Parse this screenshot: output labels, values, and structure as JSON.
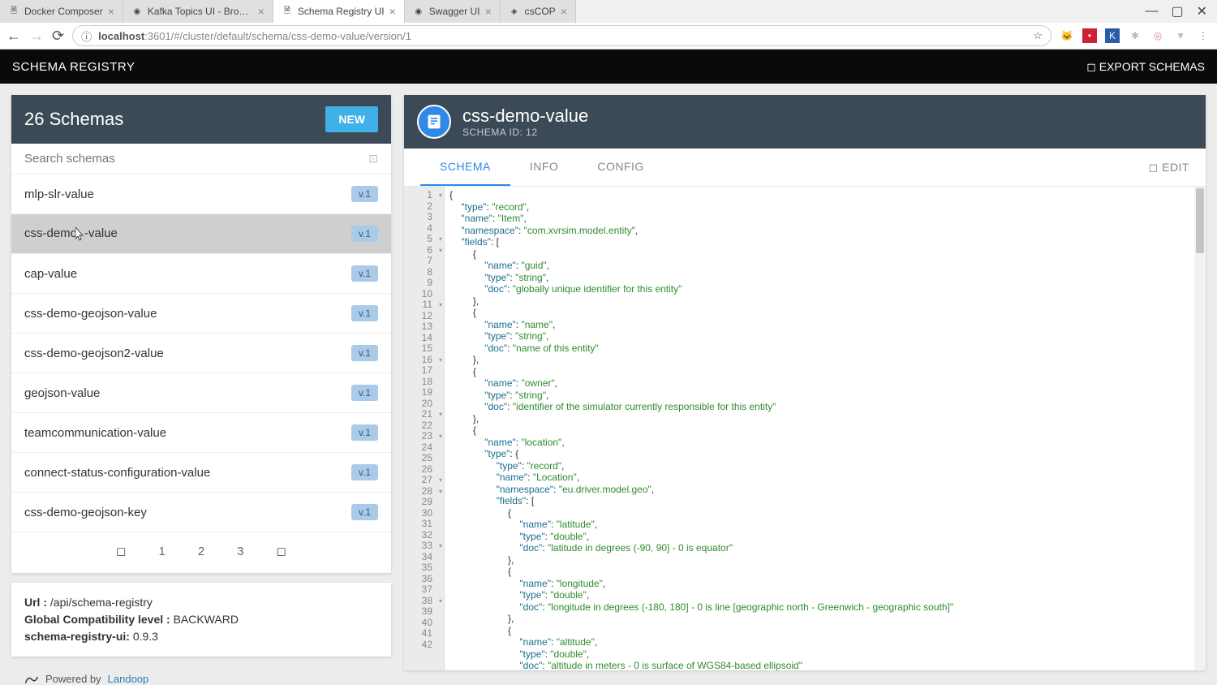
{
  "browser": {
    "tabs": [
      {
        "label": "Docker Composer",
        "icon": "🗎"
      },
      {
        "label": "Kafka Topics UI - Browse",
        "icon": "◉"
      },
      {
        "label": "Schema Registry UI",
        "icon": "🗎",
        "active": true
      },
      {
        "label": "Swagger UI",
        "icon": "◉"
      },
      {
        "label": "csCOP",
        "icon": "◈"
      }
    ],
    "url_host": "localhost",
    "url_port_path": ":3601/#/cluster/default/schema/css-demo-value/version/1"
  },
  "app": {
    "title": "SCHEMA REGISTRY",
    "export_label": "◻ EXPORT SCHEMAS"
  },
  "sidebar": {
    "header_title": "26 Schemas",
    "new_btn": "NEW",
    "search_placeholder": "Search schemas",
    "items": [
      {
        "name": "mlp-slr-value",
        "version": "v.1"
      },
      {
        "name": "css-demo-value",
        "version": "v.1",
        "active": true,
        "cursor_at": 8
      },
      {
        "name": "cap-value",
        "version": "v.1"
      },
      {
        "name": "css-demo-geojson-value",
        "version": "v.1"
      },
      {
        "name": "css-demo-geojson2-value",
        "version": "v.1"
      },
      {
        "name": "geojson-value",
        "version": "v.1"
      },
      {
        "name": "teamcommunication-value",
        "version": "v.1"
      },
      {
        "name": "connect-status-configuration-value",
        "version": "v.1"
      },
      {
        "name": "css-demo-geojson-key",
        "version": "v.1"
      }
    ],
    "pages": [
      "1",
      "2",
      "3"
    ]
  },
  "info": {
    "url_label": "Url :",
    "url_value": "/api/schema-registry",
    "compat_label": "Global Compatibility level :",
    "compat_value": "BACKWARD",
    "ver_label": "schema-registry-ui:",
    "ver_value": "0.9.3",
    "powered": "Powered by",
    "powered_link": "Landoop"
  },
  "content": {
    "title": "css-demo-value",
    "schema_id_label": "SCHEMA ID: 12",
    "tabs": {
      "schema": "SCHEMA",
      "info": "INFO",
      "config": "CONFIG"
    },
    "edit": "◻ EDIT"
  },
  "code_lines": [
    {
      "n": 1,
      "fold": true,
      "i": 0,
      "t": [
        {
          "p": "{"
        }
      ]
    },
    {
      "n": 2,
      "i": 1,
      "t": [
        {
          "k": "\"type\""
        },
        {
          "p": ": "
        },
        {
          "s": "\"record\""
        },
        {
          "p": ","
        }
      ]
    },
    {
      "n": 3,
      "i": 1,
      "t": [
        {
          "k": "\"name\""
        },
        {
          "p": ": "
        },
        {
          "s": "\"Item\""
        },
        {
          "p": ","
        }
      ]
    },
    {
      "n": 4,
      "i": 1,
      "t": [
        {
          "k": "\"namespace\""
        },
        {
          "p": ": "
        },
        {
          "s": "\"com.xvrsim.model.entity\""
        },
        {
          "p": ","
        }
      ]
    },
    {
      "n": 5,
      "fold": true,
      "i": 1,
      "t": [
        {
          "k": "\"fields\""
        },
        {
          "p": ": ["
        }
      ]
    },
    {
      "n": 6,
      "fold": true,
      "i": 2,
      "t": [
        {
          "p": "{"
        }
      ]
    },
    {
      "n": 7,
      "i": 3,
      "t": [
        {
          "k": "\"name\""
        },
        {
          "p": ": "
        },
        {
          "s": "\"guid\""
        },
        {
          "p": ","
        }
      ]
    },
    {
      "n": 8,
      "i": 3,
      "t": [
        {
          "k": "\"type\""
        },
        {
          "p": ": "
        },
        {
          "s": "\"string\""
        },
        {
          "p": ","
        }
      ]
    },
    {
      "n": 9,
      "i": 3,
      "t": [
        {
          "k": "\"doc\""
        },
        {
          "p": ": "
        },
        {
          "s": "\"globally unique identifier for this entity\""
        }
      ]
    },
    {
      "n": 10,
      "i": 2,
      "t": [
        {
          "p": "},"
        }
      ]
    },
    {
      "n": 11,
      "fold": true,
      "i": 2,
      "t": [
        {
          "p": "{"
        }
      ]
    },
    {
      "n": 12,
      "i": 3,
      "t": [
        {
          "k": "\"name\""
        },
        {
          "p": ": "
        },
        {
          "s": "\"name\""
        },
        {
          "p": ","
        }
      ]
    },
    {
      "n": 13,
      "i": 3,
      "t": [
        {
          "k": "\"type\""
        },
        {
          "p": ": "
        },
        {
          "s": "\"string\""
        },
        {
          "p": ","
        }
      ]
    },
    {
      "n": 14,
      "i": 3,
      "t": [
        {
          "k": "\"doc\""
        },
        {
          "p": ": "
        },
        {
          "s": "\"name of this entity\""
        }
      ]
    },
    {
      "n": 15,
      "i": 2,
      "t": [
        {
          "p": "},"
        }
      ]
    },
    {
      "n": 16,
      "fold": true,
      "i": 2,
      "t": [
        {
          "p": "{"
        }
      ]
    },
    {
      "n": 17,
      "i": 3,
      "t": [
        {
          "k": "\"name\""
        },
        {
          "p": ": "
        },
        {
          "s": "\"owner\""
        },
        {
          "p": ","
        }
      ]
    },
    {
      "n": 18,
      "i": 3,
      "t": [
        {
          "k": "\"type\""
        },
        {
          "p": ": "
        },
        {
          "s": "\"string\""
        },
        {
          "p": ","
        }
      ]
    },
    {
      "n": 19,
      "i": 3,
      "t": [
        {
          "k": "\"doc\""
        },
        {
          "p": ": "
        },
        {
          "s": "\"identifier of the simulator currently responsible for this entity\""
        }
      ]
    },
    {
      "n": 20,
      "i": 2,
      "t": [
        {
          "p": "},"
        }
      ]
    },
    {
      "n": 21,
      "fold": true,
      "i": 2,
      "t": [
        {
          "p": "{"
        }
      ]
    },
    {
      "n": 22,
      "i": 3,
      "t": [
        {
          "k": "\"name\""
        },
        {
          "p": ": "
        },
        {
          "s": "\"location\""
        },
        {
          "p": ","
        }
      ]
    },
    {
      "n": 23,
      "fold": true,
      "i": 3,
      "t": [
        {
          "k": "\"type\""
        },
        {
          "p": ": {"
        }
      ]
    },
    {
      "n": 24,
      "i": 4,
      "t": [
        {
          "k": "\"type\""
        },
        {
          "p": ": "
        },
        {
          "s": "\"record\""
        },
        {
          "p": ","
        }
      ]
    },
    {
      "n": 25,
      "i": 4,
      "t": [
        {
          "k": "\"name\""
        },
        {
          "p": ": "
        },
        {
          "s": "\"Location\""
        },
        {
          "p": ","
        }
      ]
    },
    {
      "n": 26,
      "i": 4,
      "t": [
        {
          "k": "\"namespace\""
        },
        {
          "p": ": "
        },
        {
          "s": "\"eu.driver.model.geo\""
        },
        {
          "p": ","
        }
      ]
    },
    {
      "n": 27,
      "fold": true,
      "i": 4,
      "t": [
        {
          "k": "\"fields\""
        },
        {
          "p": ": ["
        }
      ]
    },
    {
      "n": 28,
      "fold": true,
      "i": 5,
      "t": [
        {
          "p": "{"
        }
      ]
    },
    {
      "n": 29,
      "i": 6,
      "t": [
        {
          "k": "\"name\""
        },
        {
          "p": ": "
        },
        {
          "s": "\"latitude\""
        },
        {
          "p": ","
        }
      ]
    },
    {
      "n": 30,
      "i": 6,
      "t": [
        {
          "k": "\"type\""
        },
        {
          "p": ": "
        },
        {
          "s": "\"double\""
        },
        {
          "p": ","
        }
      ]
    },
    {
      "n": 31,
      "i": 6,
      "t": [
        {
          "k": "\"doc\""
        },
        {
          "p": ": "
        },
        {
          "s": "\"latitude in degrees (-90, 90] - 0 is equator\""
        }
      ]
    },
    {
      "n": 32,
      "i": 5,
      "t": [
        {
          "p": "},"
        }
      ]
    },
    {
      "n": 33,
      "fold": true,
      "i": 5,
      "t": [
        {
          "p": "{"
        }
      ]
    },
    {
      "n": 34,
      "i": 6,
      "t": [
        {
          "k": "\"name\""
        },
        {
          "p": ": "
        },
        {
          "s": "\"longitude\""
        },
        {
          "p": ","
        }
      ]
    },
    {
      "n": 35,
      "i": 6,
      "t": [
        {
          "k": "\"type\""
        },
        {
          "p": ": "
        },
        {
          "s": "\"double\""
        },
        {
          "p": ","
        }
      ]
    },
    {
      "n": 36,
      "i": 6,
      "t": [
        {
          "k": "\"doc\""
        },
        {
          "p": ": "
        },
        {
          "s": "\"longitude in degrees (-180, 180] - 0 is line [geographic north - Greenwich - geographic south]\""
        }
      ]
    },
    {
      "n": 37,
      "i": 5,
      "t": [
        {
          "p": "},"
        }
      ]
    },
    {
      "n": 38,
      "fold": true,
      "i": 5,
      "t": [
        {
          "p": "{"
        }
      ]
    },
    {
      "n": 39,
      "i": 6,
      "t": [
        {
          "k": "\"name\""
        },
        {
          "p": ": "
        },
        {
          "s": "\"altitude\""
        },
        {
          "p": ","
        }
      ]
    },
    {
      "n": 40,
      "i": 6,
      "t": [
        {
          "k": "\"type\""
        },
        {
          "p": ": "
        },
        {
          "s": "\"double\""
        },
        {
          "p": ","
        }
      ]
    },
    {
      "n": 41,
      "i": 6,
      "t": [
        {
          "k": "\"doc\""
        },
        {
          "p": ": "
        },
        {
          "s": "\"altitude in meters - 0 is surface of WGS84-based ellipsoid\""
        }
      ]
    },
    {
      "n": 42,
      "i": 5,
      "t": [
        {
          "p": ""
        }
      ]
    }
  ]
}
